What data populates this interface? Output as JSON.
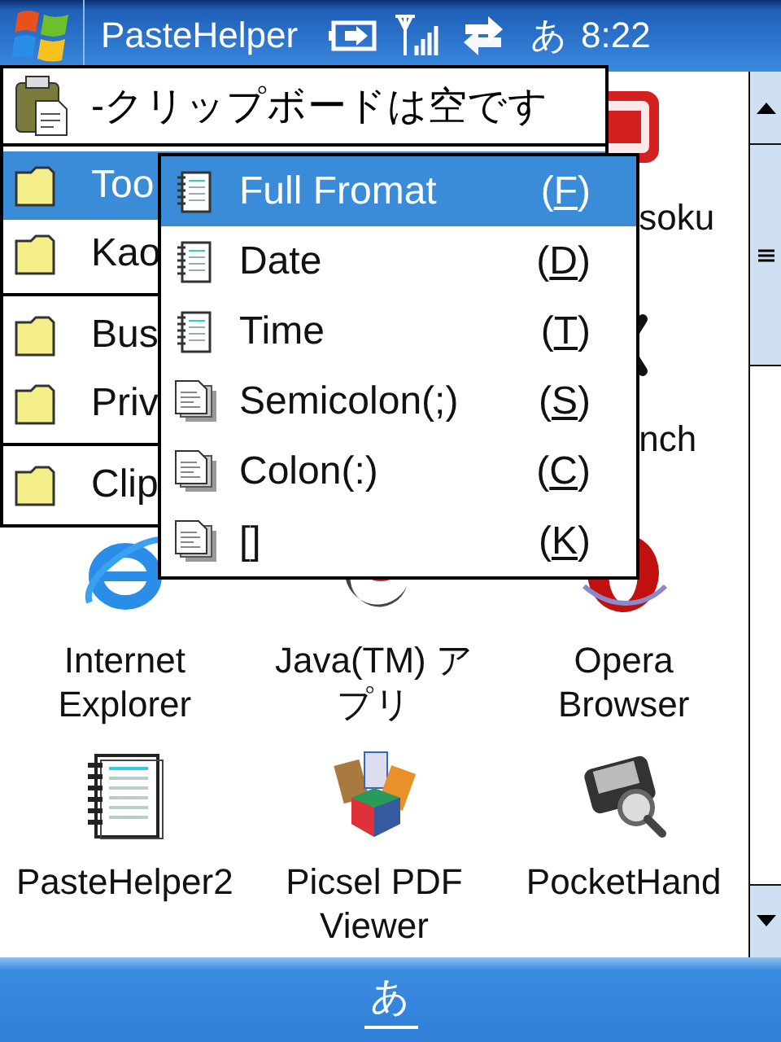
{
  "title_bar": {
    "title": "PasteHelper",
    "input_mode": "あ",
    "time": "8:22"
  },
  "apps": [
    {
      "label": "soku",
      "kind": "partial"
    },
    {
      "label": "nch",
      "kind": "partial"
    },
    {
      "label": "Internet Explorer",
      "kind": "full"
    },
    {
      "label": "Java(TM) アプリ",
      "kind": "full"
    },
    {
      "label": "Opera Browser",
      "kind": "full"
    },
    {
      "label": "PasteHelper2",
      "kind": "full"
    },
    {
      "label": "Picsel PDF Viewer",
      "kind": "full"
    },
    {
      "label": "PocketHand",
      "kind": "full"
    }
  ],
  "menu": {
    "header": "-クリップボードは空です",
    "groups": [
      {
        "items": [
          {
            "label": "Too",
            "selected": true
          },
          {
            "label": "Kao",
            "selected": false
          }
        ]
      },
      {
        "items": [
          {
            "label": "Bus",
            "selected": false
          },
          {
            "label": "Priv",
            "selected": false
          }
        ]
      },
      {
        "items": [
          {
            "label": "Clip",
            "selected": false
          }
        ]
      }
    ]
  },
  "submenu": {
    "items": [
      {
        "label": "Full Fromat",
        "shortcut": "(F)",
        "kind": "notebook",
        "selected": true
      },
      {
        "label": "Date",
        "shortcut": "(D)",
        "kind": "notebook",
        "selected": false
      },
      {
        "label": "Time",
        "shortcut": "(T)",
        "kind": "notebook",
        "selected": false
      },
      {
        "label": "Semicolon(;)",
        "shortcut": "(S)",
        "kind": "page",
        "selected": false
      },
      {
        "label": "Colon(:)",
        "shortcut": "(C)",
        "kind": "page",
        "selected": false
      },
      {
        "label": "[]",
        "shortcut": "(K)",
        "kind": "page",
        "selected": false
      }
    ]
  },
  "bottom_bar": {
    "input_mode": "あ"
  }
}
